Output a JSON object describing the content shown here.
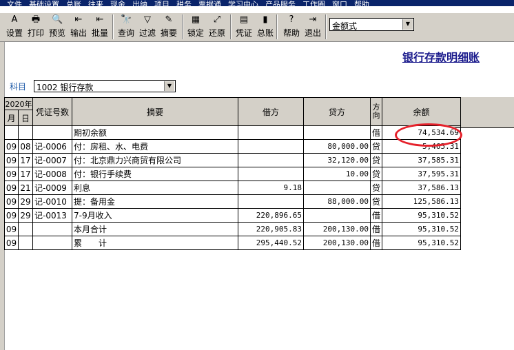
{
  "menu": [
    "文件",
    "基础设置",
    "总账",
    "往来",
    "现金",
    "出纳",
    "项目",
    "税务",
    "票据通",
    "学习中心",
    "产品服务",
    "工作圈",
    "窗口",
    "帮助"
  ],
  "toolbar": {
    "buttons": [
      {
        "label": "设置",
        "icon": "A"
      },
      {
        "label": "打印",
        "icon": "🖶"
      },
      {
        "label": "预览",
        "icon": "🔍"
      },
      {
        "label": "输出",
        "icon": "⇤"
      },
      {
        "label": "批量",
        "icon": "⇤"
      },
      {
        "label": "查询",
        "icon": "🔭"
      },
      {
        "label": "过滤",
        "icon": "▽"
      },
      {
        "label": "摘要",
        "icon": "✎"
      },
      {
        "label": "锁定",
        "icon": "▦"
      },
      {
        "label": "还原",
        "icon": "⤢"
      },
      {
        "label": "凭证",
        "icon": "▤"
      },
      {
        "label": "总账",
        "icon": "▮"
      },
      {
        "label": "帮助",
        "icon": "?"
      },
      {
        "label": "退出",
        "icon": "⇥"
      }
    ],
    "format_select": "金额式"
  },
  "title": "银行存款明细账",
  "subject": {
    "label": "科目",
    "value": "1002 银行存款"
  },
  "table": {
    "year": "2020年",
    "headers": {
      "month": "月",
      "day": "日",
      "voucher": "凭证号数",
      "summary": "摘要",
      "debit": "借方",
      "credit": "贷方",
      "direction": "方向",
      "balance": "余额"
    },
    "rows": [
      {
        "month": "",
        "day": "",
        "voucher": "",
        "summary": "期初余额",
        "debit": "",
        "credit": "",
        "dir": "借",
        "balance": "74,534.69"
      },
      {
        "month": "09",
        "day": "08",
        "voucher": "记-0006",
        "summary": "付：房租、水、电费",
        "debit": "",
        "credit": "80,000.00",
        "dir": "贷",
        "balance": "5,465.31"
      },
      {
        "month": "09",
        "day": "17",
        "voucher": "记-0007",
        "summary": "付：北京鼎力兴商贸有限公司",
        "debit": "",
        "credit": "32,120.00",
        "dir": "贷",
        "balance": "37,585.31"
      },
      {
        "month": "09",
        "day": "17",
        "voucher": "记-0008",
        "summary": "付：银行手续费",
        "debit": "",
        "credit": "10.00",
        "dir": "贷",
        "balance": "37,595.31"
      },
      {
        "month": "09",
        "day": "21",
        "voucher": "记-0009",
        "summary": "利息",
        "debit": "9.18",
        "credit": "",
        "dir": "贷",
        "balance": "37,586.13"
      },
      {
        "month": "09",
        "day": "29",
        "voucher": "记-0010",
        "summary": "提：备用金",
        "debit": "",
        "credit": "88,000.00",
        "dir": "贷",
        "balance": "125,586.13"
      },
      {
        "month": "09",
        "day": "29",
        "voucher": "记-0013",
        "summary": "7-9月收入",
        "debit": "220,896.65",
        "credit": "",
        "dir": "借",
        "balance": "95,310.52"
      },
      {
        "month": "09",
        "day": "",
        "voucher": "",
        "summary": "本月合计",
        "debit": "220,905.83",
        "credit": "200,130.00",
        "dir": "借",
        "balance": "95,310.52"
      },
      {
        "month": "09",
        "day": "",
        "voucher": "",
        "summary": "累　　计",
        "debit": "295,440.52",
        "credit": "200,130.00",
        "dir": "借",
        "balance": "95,310.52"
      }
    ]
  },
  "colors": {
    "title": "#1a1a8c",
    "highlight_circle": "#e5202a",
    "menubar": "#0a246a",
    "toolbar": "#d4d0c8"
  }
}
